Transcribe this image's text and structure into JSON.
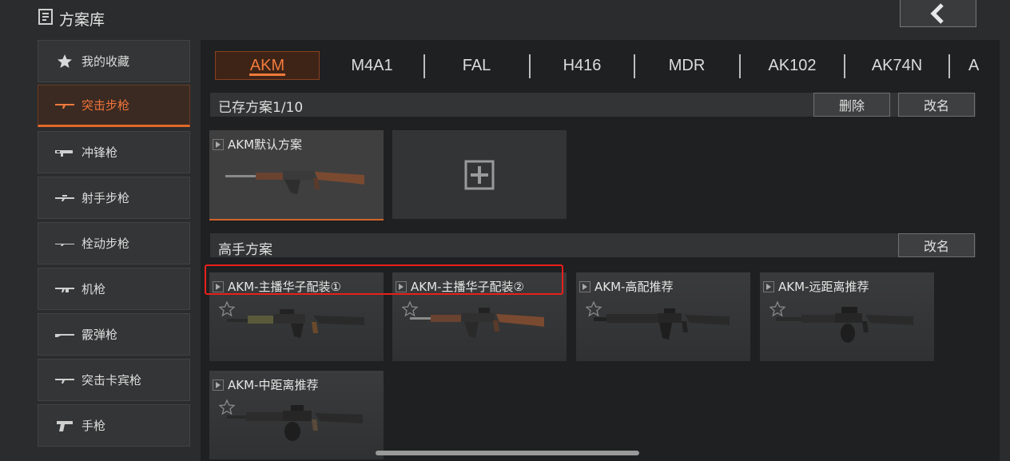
{
  "header": {
    "title": "方案库",
    "back_icon": "chevron-left-icon"
  },
  "sidebar": {
    "items": [
      {
        "label": "我的收藏",
        "icon": "star-icon",
        "active": false
      },
      {
        "label": "突击步枪",
        "icon": "assault-rifle-icon",
        "active": true
      },
      {
        "label": "冲锋枪",
        "icon": "smg-icon",
        "active": false
      },
      {
        "label": "射手步枪",
        "icon": "marksman-rifle-icon",
        "active": false
      },
      {
        "label": "栓动步枪",
        "icon": "bolt-rifle-icon",
        "active": false
      },
      {
        "label": "机枪",
        "icon": "machine-gun-icon",
        "active": false
      },
      {
        "label": "霰弹枪",
        "icon": "shotgun-icon",
        "active": false
      },
      {
        "label": "突击卡宾枪",
        "icon": "carbine-icon",
        "active": false
      },
      {
        "label": "手枪",
        "icon": "pistol-icon",
        "active": false
      }
    ]
  },
  "tabs": {
    "items": [
      {
        "label": "AKM",
        "active": true
      },
      {
        "label": "M4A1",
        "active": false
      },
      {
        "label": "FAL",
        "active": false
      },
      {
        "label": "H416",
        "active": false
      },
      {
        "label": "MDR",
        "active": false
      },
      {
        "label": "AK102",
        "active": false
      },
      {
        "label": "AK74N",
        "active": false
      },
      {
        "label": "A",
        "active": false
      }
    ]
  },
  "saved": {
    "title": "已存方案1/10",
    "delete_label": "删除",
    "rename_label": "改名",
    "cards": [
      {
        "title": "AKM默认方案",
        "selected": true
      }
    ]
  },
  "expert": {
    "title": "高手方案",
    "rename_label": "改名",
    "cards": [
      {
        "title": "AKM-主播华子配装①"
      },
      {
        "title": "AKM-主播华子配装②"
      },
      {
        "title": "AKM-高配推荐"
      },
      {
        "title": "AKM-远距离推荐"
      },
      {
        "title": "AKM-中距离推荐"
      }
    ]
  },
  "colors": {
    "accent": "#f07a3c",
    "highlight": "#e8201c",
    "panel": "#1f2021"
  }
}
